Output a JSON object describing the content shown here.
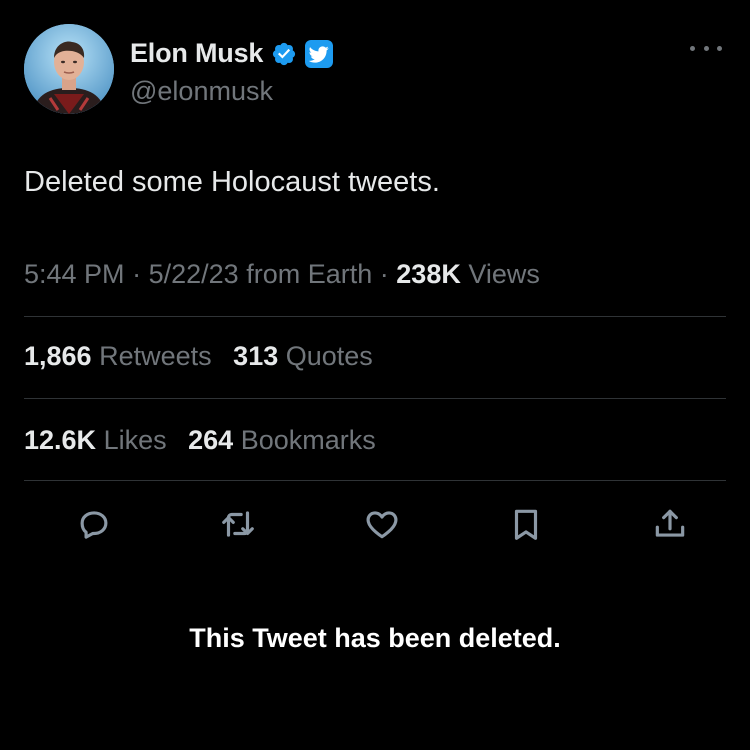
{
  "profile": {
    "display_name": "Elon Musk",
    "handle": "@elonmusk",
    "verified_icon": "verified-badge-icon",
    "twitter_icon": "twitter-bird-icon"
  },
  "tweet": {
    "text": "Deleted some Holocaust tweets."
  },
  "meta": {
    "time": "5:44 PM",
    "sep1": "·",
    "date": "5/22/23",
    "source": "from Earth",
    "sep2": "·",
    "views_count": "238K",
    "views_label": "Views"
  },
  "stats": {
    "retweets_count": "1,866",
    "retweets_label": "Retweets",
    "quotes_count": "313",
    "quotes_label": "Quotes",
    "likes_count": "12.6K",
    "likes_label": "Likes",
    "bookmarks_count": "264",
    "bookmarks_label": "Bookmarks"
  },
  "actions": [
    "reply-icon",
    "retweet-icon",
    "like-icon",
    "bookmark-icon",
    "share-icon"
  ],
  "notice": "This Tweet has been deleted.",
  "colors": {
    "background": "#000000",
    "primary_text": "#e7e9ea",
    "secondary_text": "#71767b",
    "divider": "#2f3336",
    "accent": "#1d9bf0"
  }
}
